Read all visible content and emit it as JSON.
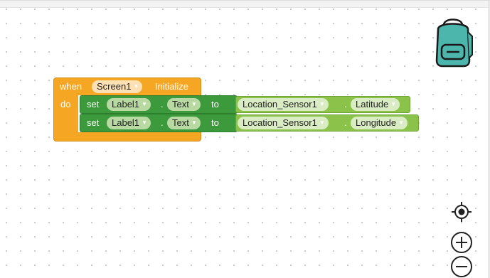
{
  "workspace": {
    "event_block": {
      "when_label": "when",
      "component": "Screen1",
      "event": "Initialize",
      "do_label": "do"
    },
    "statements": [
      {
        "set_label": "set",
        "component": "Label1",
        "dot": ".",
        "property": "Text",
        "to_label": "to",
        "value_component": "Location_Sensor1",
        "value_dot": ".",
        "value_property": "Latitude"
      },
      {
        "set_label": "set",
        "component": "Label1",
        "dot": ".",
        "property": "Text",
        "to_label": "to",
        "value_component": "Location_Sensor1",
        "value_dot": ".",
        "value_property": "Longitude"
      }
    ]
  },
  "controls": {
    "backpack_icon": "backpack-icon",
    "recenter_icon": "crosshair-icon",
    "zoom_in_icon": "plus-icon",
    "zoom_out_icon": "minus-icon"
  },
  "colors": {
    "event_block": "#f5a623",
    "setter_block": "#3c9a3c",
    "getter_block": "#8bc34a",
    "backpack": "#4db6ac"
  }
}
